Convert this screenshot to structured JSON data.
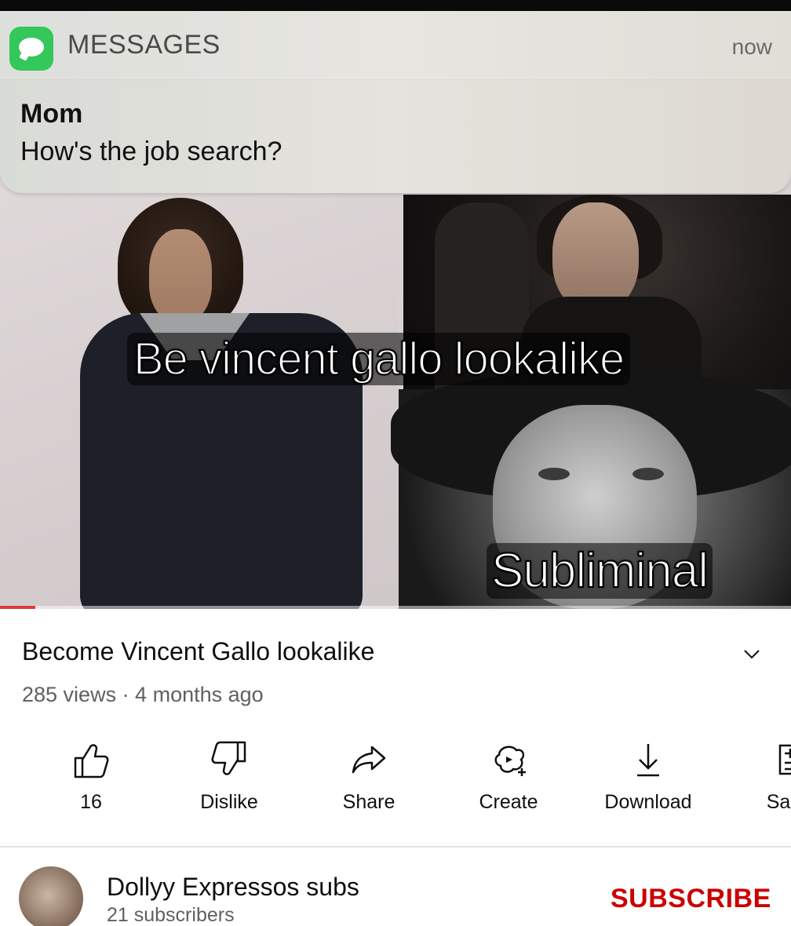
{
  "notification": {
    "app_name": "MESSAGES",
    "time": "now",
    "sender": "Mom",
    "message": "How's the job search?",
    "app_icon": "messages-app-icon",
    "icon_color": "#34c759"
  },
  "video": {
    "overlay_text_top": "Be vincent gallo lookalike",
    "overlay_text_bottom": "Subliminal",
    "progress_fraction": 0.045,
    "progress_color": "#e53935"
  },
  "info": {
    "title": "Become Vincent Gallo lookalike",
    "meta": "285 views · 4 months ago",
    "expand_icon": "chevron-down-icon"
  },
  "actions": [
    {
      "label": "16",
      "icon": "thumbs-up-icon"
    },
    {
      "label": "Dislike",
      "icon": "thumbs-down-icon"
    },
    {
      "label": "Share",
      "icon": "share-icon"
    },
    {
      "label": "Create",
      "icon": "create-icon"
    },
    {
      "label": "Download",
      "icon": "download-icon"
    },
    {
      "label": "Sa",
      "icon": "save-icon"
    }
  ],
  "channel": {
    "name": "Dollyy Expressos subs",
    "subscribers": "21 subscribers",
    "subscribe_label": "SUBSCRIBE",
    "subscribe_color": "#cc0000"
  }
}
